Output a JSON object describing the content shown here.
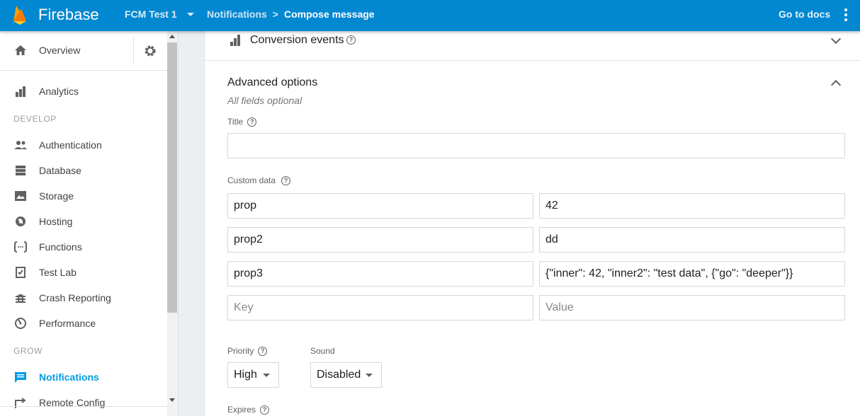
{
  "topbar": {
    "brand": "Firebase",
    "project": "FCM Test 1",
    "breadcrumb": [
      "Notifications",
      ">",
      "Compose message"
    ],
    "docs_link": "Go to docs"
  },
  "sidebar": {
    "overview": "Overview",
    "analytics": "Analytics",
    "section_develop": "DEVELOP",
    "develop_items": [
      "Authentication",
      "Database",
      "Storage",
      "Hosting",
      "Functions",
      "Test Lab",
      "Crash Reporting",
      "Performance"
    ],
    "section_grow": "GROW",
    "grow_items": [
      "Notifications",
      "Remote Config"
    ],
    "active_item": "Notifications"
  },
  "main": {
    "conversion_events": "Conversion events",
    "advanced": {
      "title": "Advanced options",
      "subtitle": "All fields optional",
      "title_label": "Title",
      "title_value": "",
      "custom_data_label": "Custom data",
      "custom_data": [
        {
          "key": "prop",
          "value": "42"
        },
        {
          "key": "prop2",
          "value": "dd"
        },
        {
          "key": "prop3",
          "value": "{\"inner\": 42, \"inner2\": \"test data\", {\"go\": \"deeper\"}}"
        }
      ],
      "key_placeholder": "Key",
      "value_placeholder": "Value",
      "priority_label": "Priority",
      "priority_value": "High",
      "sound_label": "Sound",
      "sound_value": "Disabled",
      "expires_label": "Expires"
    }
  },
  "colors": {
    "topbar": "#0288d1",
    "active_nav": "#039be5",
    "logo_flame": "#ffca28"
  }
}
